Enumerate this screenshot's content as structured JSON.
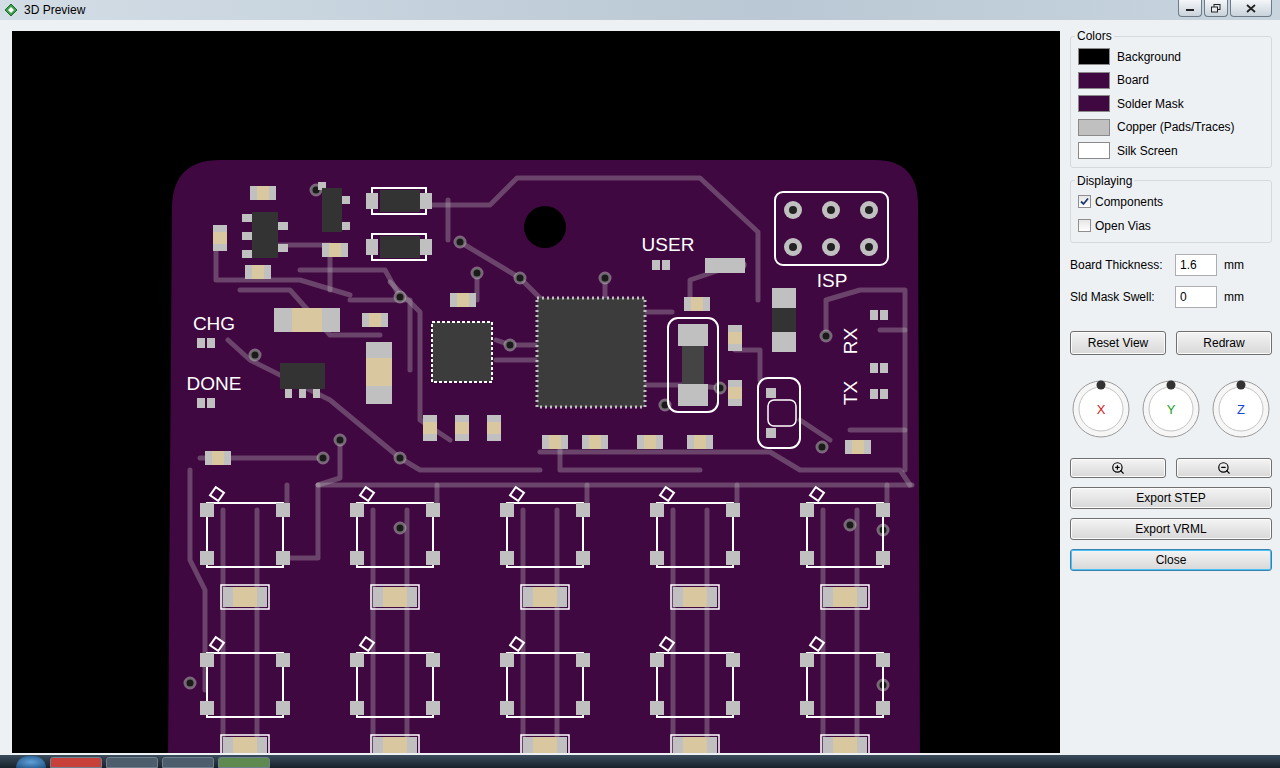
{
  "window": {
    "title": "3D Preview"
  },
  "silkscreen_labels": [
    "CHG",
    "DONE",
    "USER",
    "ISP",
    "RX",
    "TX"
  ],
  "colors": {
    "title": "Colors",
    "items": [
      {
        "label": "Background",
        "color": "#000000"
      },
      {
        "label": "Board",
        "color": "#400840"
      },
      {
        "label": "Solder Mask",
        "color": "#400840"
      },
      {
        "label": "Copper (Pads/Traces)",
        "color": "#c0c0c0"
      },
      {
        "label": "Silk Screen",
        "color": "#ffffff"
      }
    ]
  },
  "displaying": {
    "title": "Displaying",
    "items": [
      {
        "label": "Components",
        "checked": true
      },
      {
        "label": "Open Vias",
        "checked": false
      }
    ]
  },
  "fields": [
    {
      "label": "Board Thickness:",
      "value": "1.6",
      "unit": "mm"
    },
    {
      "label": "Sld Mask Swell:",
      "value": "0",
      "unit": "mm"
    }
  ],
  "view_buttons": [
    "Reset View",
    "Redraw"
  ],
  "axes": [
    {
      "label": "X",
      "color": "#d01818"
    },
    {
      "label": "Y",
      "color": "#18a018"
    },
    {
      "label": "Z",
      "color": "#1848d0"
    }
  ],
  "export_buttons": [
    {
      "label": "Export STEP",
      "default": false
    },
    {
      "label": "Export VRML",
      "default": false
    },
    {
      "label": "Close",
      "default": true
    }
  ]
}
